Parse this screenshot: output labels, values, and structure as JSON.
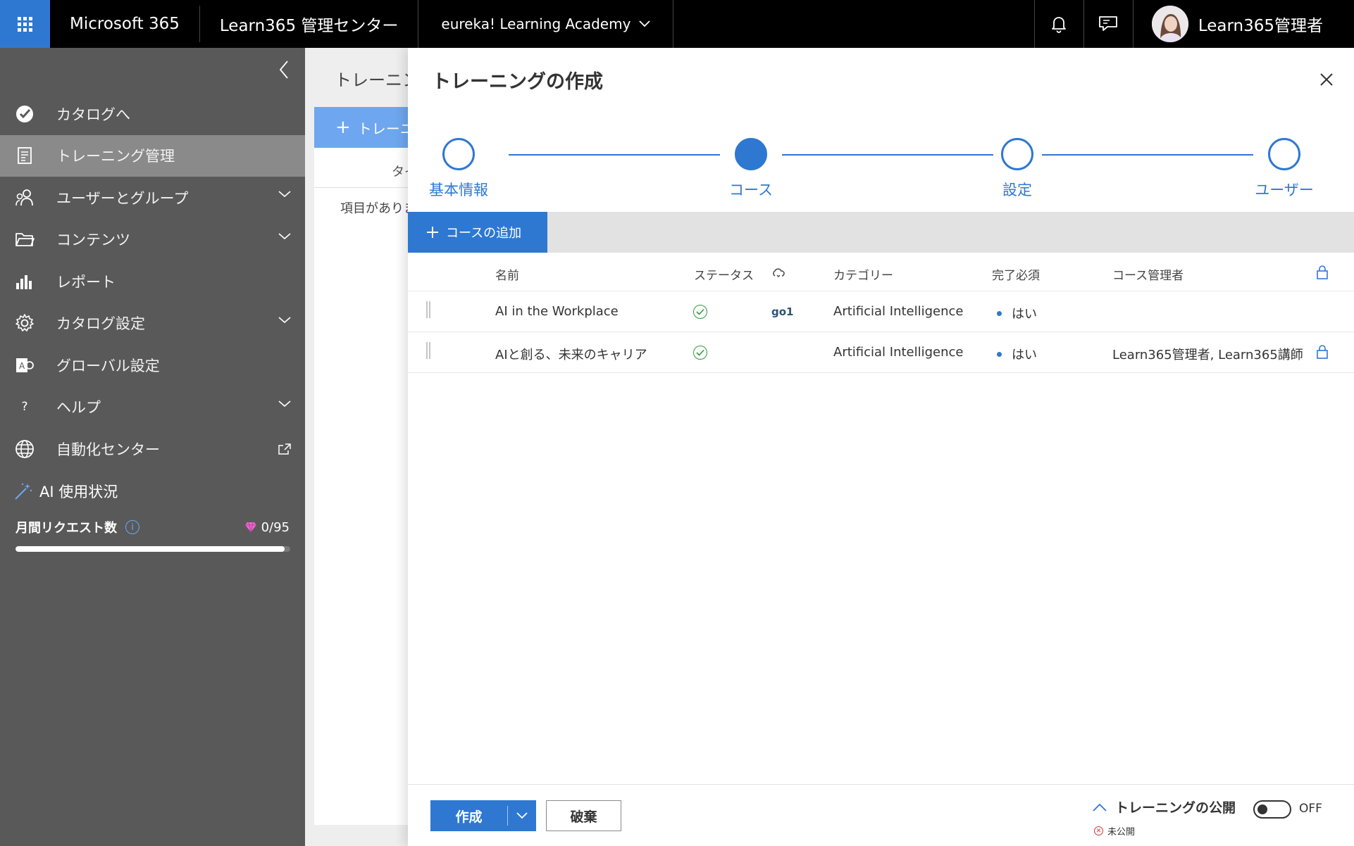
{
  "topbar": {
    "brand": "Microsoft 365",
    "app_name": "Learn365 管理センター",
    "tenant": "eureka! Learning Academy",
    "user_name": "Learn365管理者"
  },
  "sidebar": {
    "items": [
      {
        "label": "カタログへ"
      },
      {
        "label": "トレーニング管理"
      },
      {
        "label": "ユーザーとグループ"
      },
      {
        "label": "コンテンツ"
      },
      {
        "label": "レポート"
      },
      {
        "label": "カタログ設定"
      },
      {
        "label": "グローバル設定"
      },
      {
        "label": "ヘルプ"
      },
      {
        "label": "自動化センター"
      }
    ],
    "ai_title": "AI 使用状況",
    "monthly_requests_label": "月間リクエスト数",
    "request_count": "0/95",
    "request_progress": 0.98
  },
  "background": {
    "title": "トレーニング",
    "add_button": "トレーニ",
    "column": "タイ",
    "empty": "項目がありません"
  },
  "panel": {
    "title": "トレーニングの作成",
    "steps": [
      {
        "label": "基本情報",
        "state": "done"
      },
      {
        "label": "コース",
        "state": "current"
      },
      {
        "label": "設定",
        "state": "todo"
      },
      {
        "label": "ユーザー",
        "state": "todo"
      }
    ],
    "add_course": "コースの追加",
    "columns": {
      "name": "名前",
      "status": "ステータス",
      "category": "カテゴリー",
      "required": "完了必須",
      "managers": "コース管理者"
    },
    "rows": [
      {
        "name": "AI in the Workplace",
        "provider": "go1",
        "category": "Artificial Intelligence",
        "required": "はい",
        "managers": ""
      },
      {
        "name": "AIと創る、未来のキャリア",
        "provider": "",
        "category": "Artificial Intelligence",
        "required": "はい",
        "managers": "Learn365管理者, Learn365講師"
      }
    ],
    "footer": {
      "create": "作成",
      "discard": "破棄",
      "publish_label": "トレーニングの公開",
      "unpublished": "未公開",
      "toggle_state": "OFF"
    }
  },
  "colors": {
    "accent": "#2e78d2",
    "sidebar_bg": "#595959",
    "sidebar_active": "#8a8a8a",
    "ok_green": "#2e9a3e"
  }
}
